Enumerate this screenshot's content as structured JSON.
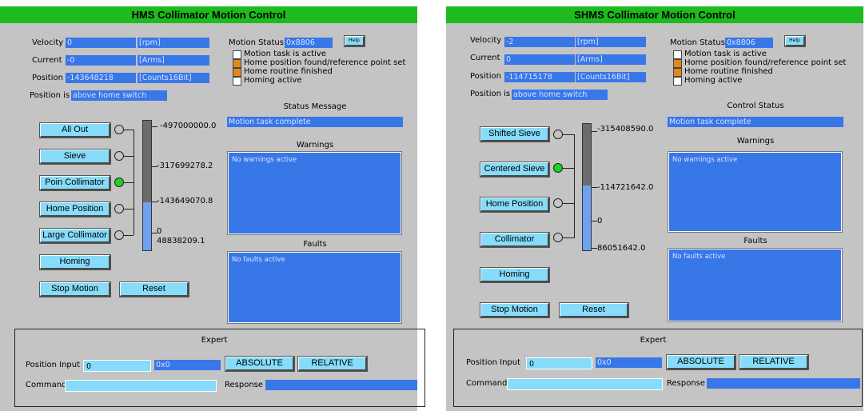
{
  "hms": {
    "title": "HMS Collimator Motion Control",
    "velocity_label": "Velocity",
    "velocity_value": "0",
    "velocity_unit": "[rpm]",
    "current_label": "Current",
    "current_value": "-0",
    "current_unit": "[Arms]",
    "position_label": "Position",
    "position_value": "-143648218",
    "position_unit": "[Counts16Bit]",
    "position_is_label": "Position is",
    "position_is_value": "above home switch",
    "motion_status_label": "Motion Status",
    "motion_status_value": "0x8806",
    "help_label": "Help",
    "status_flags": [
      {
        "label": "Motion task is active",
        "checked": false
      },
      {
        "label": "Home position found/reference point set",
        "checked": true
      },
      {
        "label": "Home routine finished",
        "checked": true
      },
      {
        "label": "Homing active",
        "checked": false
      }
    ],
    "status_message_header": "Status Message",
    "status_message_value": "Motion task complete",
    "warnings_header": "Warnings",
    "warnings_text": "No warnings active",
    "faults_header": "Faults",
    "faults_text": "No faults active",
    "positions": [
      {
        "label": "All Out",
        "active": false
      },
      {
        "label": "Sieve",
        "active": false
      },
      {
        "label": "Poin Collimator",
        "active": true
      },
      {
        "label": "Home Position",
        "active": false
      },
      {
        "label": "Large Collimator",
        "active": false
      }
    ],
    "scale_labels": [
      "-497000000.0",
      "-317699278.2",
      "-143649070.8",
      "0",
      "48838209.1"
    ],
    "bar_fill_fraction": 0.37,
    "homing_label": "Homing",
    "stop_label": "Stop Motion",
    "reset_label": "Reset",
    "expert_header": "Expert",
    "position_input_label": "Position Input",
    "position_input_value": "0",
    "position_input_hex": "0x0",
    "absolute_label": "ABSOLUTE",
    "relative_label": "RELATIVE",
    "command_label": "Command",
    "command_value": "",
    "response_label": "Response",
    "response_value": ""
  },
  "shms": {
    "title": "SHMS Collimator Motion Control",
    "velocity_label": "Velocity",
    "velocity_value": "-2",
    "velocity_unit": "[rpm]",
    "current_label": "Current",
    "current_value": "0",
    "current_unit": "[Arms]",
    "position_label": "Position",
    "position_value": "-114715178",
    "position_unit": "[Counts16Bit]",
    "position_is_label": "Position is",
    "position_is_value": "above home switch",
    "motion_status_label": "Motion Status",
    "motion_status_value": "0x8806",
    "help_label": "Help",
    "status_flags": [
      {
        "label": "Motion task is active",
        "checked": false
      },
      {
        "label": "Home position found/reference point set",
        "checked": true
      },
      {
        "label": "Home routine finished",
        "checked": true
      },
      {
        "label": "Homing active",
        "checked": false
      }
    ],
    "status_message_header": "Control Status",
    "status_message_value": "Motion task complete",
    "warnings_header": "Warnings",
    "warnings_text": "No warnings active",
    "faults_header": "Faults",
    "faults_text": "No faults active",
    "positions": [
      {
        "label": "Shifted Sieve",
        "active": false
      },
      {
        "label": "Centered Sieve",
        "active": true
      },
      {
        "label": "Home Position",
        "active": false
      },
      {
        "label": "Collimator",
        "active": false
      }
    ],
    "scale_labels": [
      "-315408590.0",
      "-114721642.0",
      "0",
      "86051642.0"
    ],
    "bar_fill_fraction": 0.51,
    "homing_label": "Homing",
    "stop_label": "Stop Motion",
    "reset_label": "Reset",
    "expert_header": "Expert",
    "position_input_label": "Position Input",
    "position_input_value": "0",
    "position_input_hex": "0x0",
    "absolute_label": "ABSOLUTE",
    "relative_label": "RELATIVE",
    "command_label": "Command",
    "command_value": "",
    "response_label": "Response",
    "response_value": ""
  },
  "colors": {
    "title_bar": "#1dbb1d",
    "panel_bg": "#c4c4c4",
    "readout_bg": "#3877e8",
    "button_bg": "#86dcfa",
    "active_indicator": "#1fd41f",
    "flag_on": "#e08a1a"
  }
}
